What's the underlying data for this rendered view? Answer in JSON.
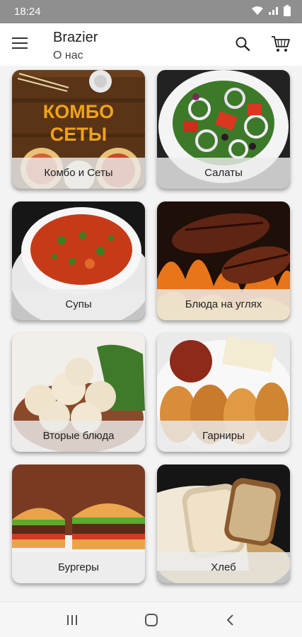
{
  "status_bar": {
    "time": "18:24",
    "icons": [
      "wifi-icon",
      "signal-icon",
      "battery-icon"
    ]
  },
  "app_bar": {
    "title": "Brazier",
    "subtitle": "О нас",
    "menu_icon": "hamburger-icon",
    "search_icon": "search-icon",
    "cart_icon": "cart-icon"
  },
  "categories": [
    {
      "label": "Комбо и Сеты",
      "image_text": "КОМБО СЕТЫ"
    },
    {
      "label": "Салаты"
    },
    {
      "label": "Супы"
    },
    {
      "label": "Блюда на углях"
    },
    {
      "label": "Вторые блюда"
    },
    {
      "label": "Гарниры"
    },
    {
      "label": "Бургеры"
    },
    {
      "label": "Хлеб"
    }
  ],
  "nav_bar": {
    "buttons": [
      "recents-icon",
      "home-icon",
      "back-icon"
    ]
  },
  "colors": {
    "status_bar": "#8f8f8f",
    "background": "#f3f3f3",
    "label_overlay": "#ebebeb",
    "combo_text": "#f0a21a"
  }
}
